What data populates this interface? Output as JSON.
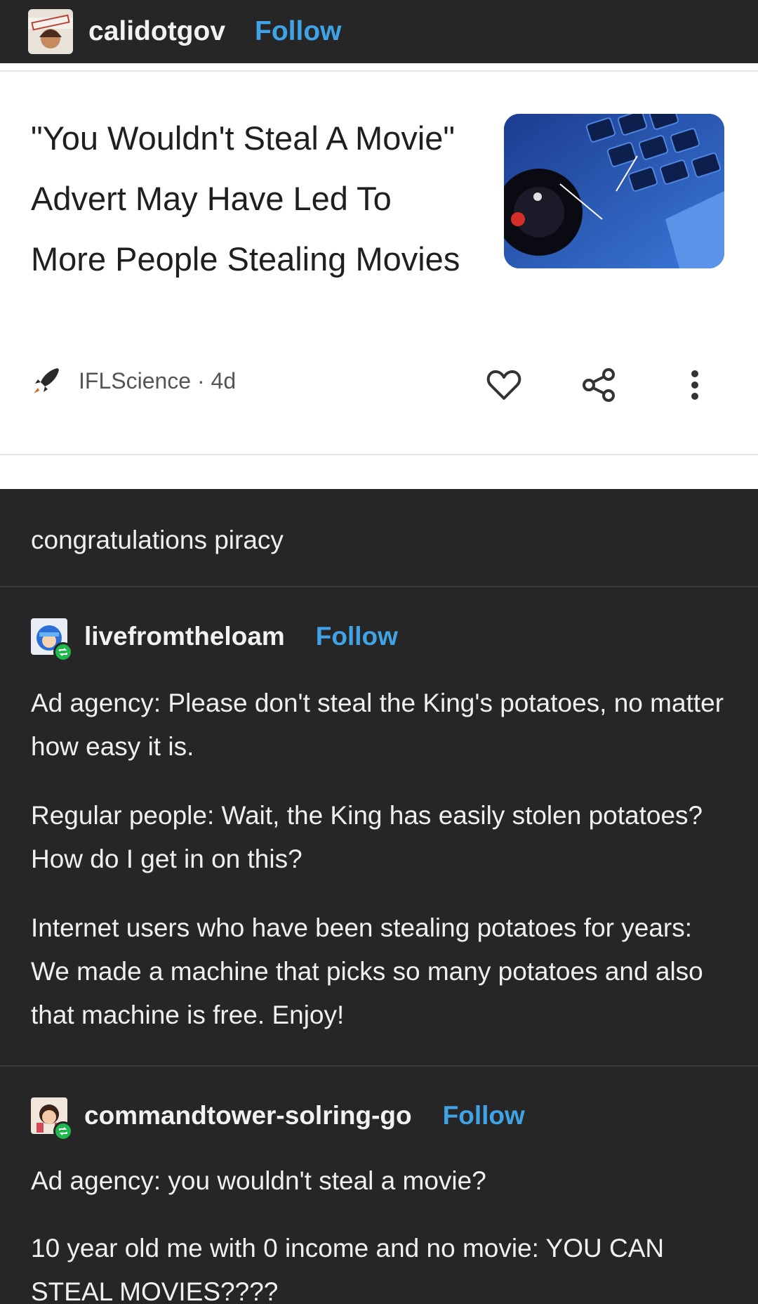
{
  "post": {
    "username": "calidotgov",
    "follow_label": "Follow"
  },
  "card": {
    "title": "\"You Wouldn't Steal A Movie\" Advert May Have Led To More People Stealing Movies",
    "source": "IFLScience · 4d"
  },
  "comment": {
    "text": "congratulations piracy"
  },
  "reblogs": [
    {
      "username": "livefromtheloam",
      "follow_label": "Follow",
      "paragraphs": [
        "Ad agency: Please don't steal the King's potatoes, no matter how easy it is.",
        "Regular people: Wait, the King has easily stolen potatoes? How do I get in on this?",
        "Internet users who have been stealing potatoes for years: We made a machine that picks so many potatoes and also that machine is free. Enjoy!"
      ]
    },
    {
      "username": "commandtower-solring-go",
      "follow_label": "Follow",
      "paragraphs": [
        "Ad agency: you wouldn't steal a movie?",
        "10 year old me with 0 income and no movie: YOU CAN STEAL MOVIES????"
      ]
    }
  ],
  "icons": {
    "source": "rocket-icon",
    "like": "heart-icon",
    "share": "share-icon",
    "more": "more-vertical-icon",
    "reblog_badge": "reblog-icon"
  },
  "colors": {
    "follow": "#3fa3e6",
    "background": "#262626",
    "card": "#ffffff",
    "reblog_badge": "#1fb84f"
  }
}
